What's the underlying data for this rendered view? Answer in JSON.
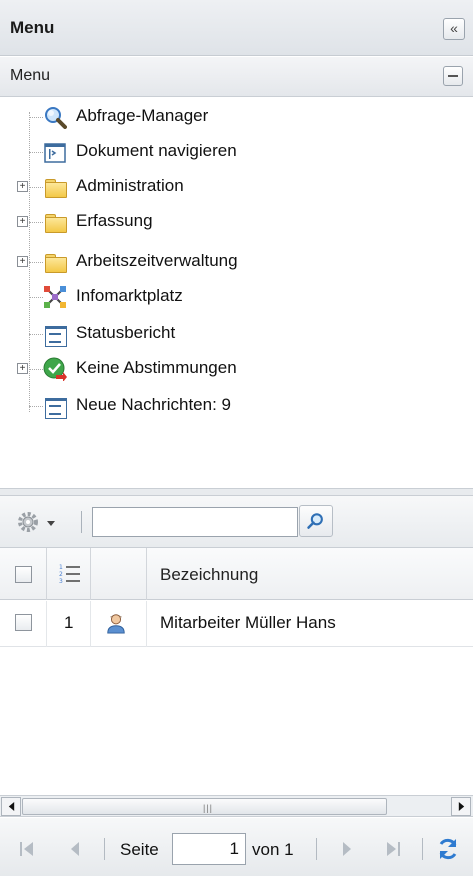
{
  "header": {
    "title": "Menu",
    "collapse_icon": "double-chevron-left-icon",
    "collapse_label": "«"
  },
  "section": {
    "title": "Menu"
  },
  "tree": {
    "items": [
      {
        "label": "Abfrage-Manager",
        "icon": "magnifier-icon",
        "expandable": false
      },
      {
        "label": "Dokument navigieren",
        "icon": "document-navigate-icon",
        "expandable": false
      },
      {
        "label": "Administration",
        "icon": "folder-icon",
        "expandable": true
      },
      {
        "label": "Erfassung",
        "icon": "folder-icon",
        "expandable": true
      },
      {
        "label": "Arbeitszeitverwaltung",
        "icon": "folder-icon",
        "expandable": true
      },
      {
        "label": "Infomarktplatz",
        "icon": "network-icon",
        "expandable": false
      },
      {
        "label": "Statusbericht",
        "icon": "report-icon",
        "expandable": false
      },
      {
        "label": "Keine Abstimmungen",
        "icon": "check-badge-icon",
        "expandable": true
      },
      {
        "label": "Neue Nachrichten: 9",
        "icon": "report-icon",
        "expandable": false
      }
    ]
  },
  "toolbar": {
    "settings_icon": "gear-icon",
    "search_value": "",
    "search_icon": "search-icon"
  },
  "grid": {
    "columns": [
      "",
      "",
      "",
      "Bezeichnung"
    ],
    "rows": [
      {
        "num": "1",
        "icon": "person-icon",
        "name": "Mitarbeiter Müller Hans"
      }
    ]
  },
  "pager": {
    "page_label": "Seite",
    "page_value": "1",
    "of_label": "von 1"
  }
}
